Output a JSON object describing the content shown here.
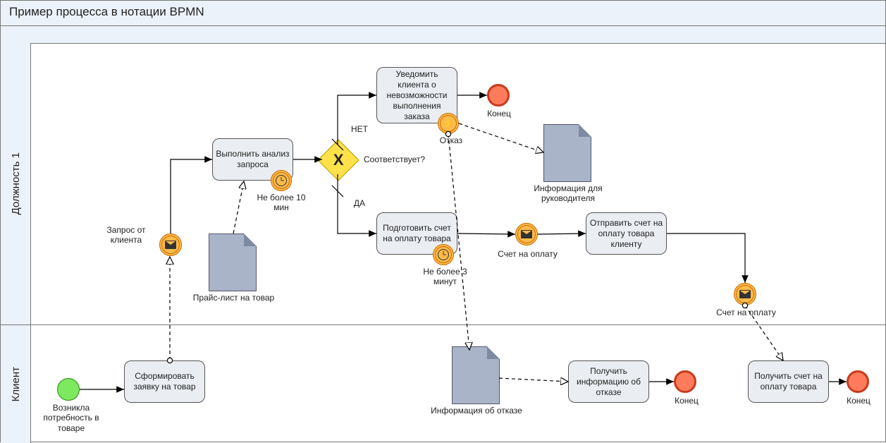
{
  "title": "Пример процесса в нотации BPMN",
  "lanes": {
    "role1": "Должность 1",
    "client": "Клиент"
  },
  "events": {
    "start_label": "Возникла потребность в товаре",
    "msg_request_label": "Запрос от клиента",
    "refusal_label": "Отказ",
    "invoice_msg1": "Счет на оплату",
    "invoice_msg2": "Счет на оплату",
    "end1": "Конец",
    "end2": "Конец",
    "end3": "Конец"
  },
  "tasks": {
    "form_request": "Сформировать заявку на товар",
    "analyze": "Выполнить анализ запроса",
    "notify_impossible": "Уведомить клиента о невозможности выполнения заказа",
    "prepare_invoice": "Подготовить счет на оплату товара",
    "send_invoice": "Отправить счет на оплату товара клиенту",
    "receive_refusal": "Получить информацию об отказе",
    "receive_invoice": "Получить счет на оплату товара"
  },
  "timers": {
    "t10": "Не более 10 мин",
    "t3": "Не более 3 минут"
  },
  "gateway": {
    "label": "Соответствует?",
    "no": "НЕТ",
    "yes": "ДА"
  },
  "docs": {
    "pricelist": "Прайс-лист на товар",
    "mgr_info": "Информация для руководителя",
    "refusal_info": "Информация об отказе"
  }
}
